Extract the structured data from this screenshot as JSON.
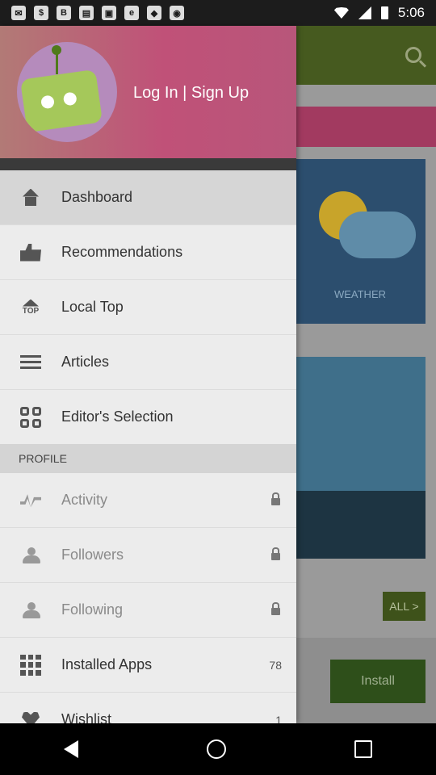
{
  "status_bar": {
    "time": "5:06",
    "notification_icons": [
      "email-icon",
      "cash-icon",
      "bitcoin-icon",
      "shop-icon",
      "ticket-icon",
      "esc-icon",
      "shield-icon",
      "camera-icon"
    ]
  },
  "background": {
    "weather_label": "WEATHER",
    "all_button": "ALL >",
    "install_button": "Install"
  },
  "drawer": {
    "login_label": "Log In | Sign Up",
    "items": [
      {
        "label": "Dashboard",
        "icon": "home-icon"
      },
      {
        "label": "Recommendations",
        "icon": "thumbs-up-icon"
      },
      {
        "label": "Local Top",
        "icon": "top-icon"
      },
      {
        "label": "Articles",
        "icon": "articles-icon"
      },
      {
        "label": "Editor's Selection",
        "icon": "grid-icon"
      }
    ],
    "profile_section": "PROFILE",
    "profile_items": [
      {
        "label": "Activity",
        "icon": "activity-icon",
        "locked": true
      },
      {
        "label": "Followers",
        "icon": "followers-icon",
        "locked": true
      },
      {
        "label": "Following",
        "icon": "following-icon",
        "locked": true
      },
      {
        "label": "Installed Apps",
        "icon": "apps-icon",
        "count": "78"
      },
      {
        "label": "Wishlist",
        "icon": "heart-icon",
        "count": "1"
      }
    ]
  }
}
